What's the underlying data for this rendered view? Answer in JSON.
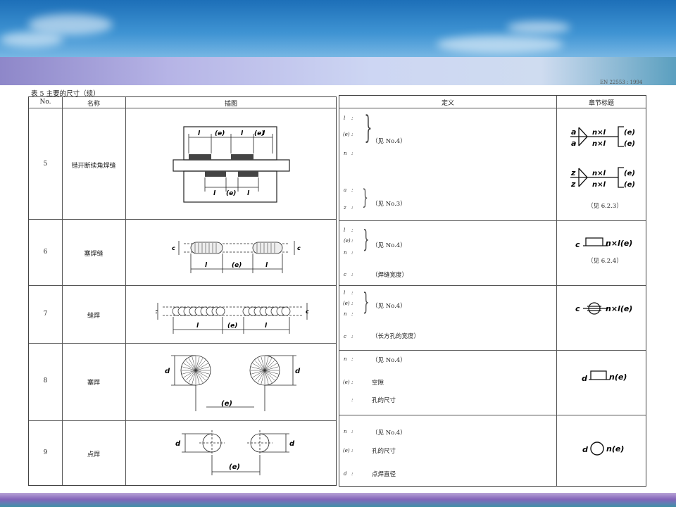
{
  "table": {
    "caption": "表 5  主要的尺寸（续）",
    "doc_code": "EN 22553 : 1994",
    "headers": {
      "no": "No.",
      "name": "名称",
      "figure": "插图",
      "definition": "定义",
      "section": "章节标题"
    },
    "rows": [
      {
        "no": "5",
        "name": "错开断续角焊缝",
        "figure_labels": {
          "l1": "l",
          "e1": "(e)",
          "l2": "l",
          "e2": "(e)",
          "l3": "l",
          "l4": "l",
          "e3": "(e)",
          "l5": "l"
        },
        "definitions": [
          {
            "symbols": [
              "l",
              "(e)",
              "n"
            ],
            "text": "（见 No.4）"
          },
          {
            "symbols": [
              "a",
              "z"
            ],
            "text": "（见 No.3）"
          }
        ],
        "symbols": [
          {
            "top": "a",
            "bottom": "a",
            "top_text": "n×l",
            "bottom_text": "n×l",
            "top_e": "(e)",
            "bottom_e": "(e)"
          },
          {
            "top": "z",
            "bottom": "z",
            "top_text": "n×l",
            "bottom_text": "n×l",
            "top_e": "(e)",
            "bottom_e": "(e)"
          }
        ],
        "ref": "（见 6.2.3）"
      },
      {
        "no": "6",
        "name": "塞焊缝",
        "figure_labels": {
          "c1": "c",
          "c2": "c",
          "l1": "l",
          "e": "(e)",
          "l2": "l"
        },
        "definitions": [
          {
            "symbols": [
              "l",
              "(e)",
              "n"
            ],
            "text": "（见 No.4）"
          },
          {
            "symbols": [
              "c"
            ],
            "text": "（焊缝宽度）"
          }
        ],
        "symbol_text": "n×l(e)",
        "symbol_prefix": "c",
        "ref": "（见 6.2.4）"
      },
      {
        "no": "7",
        "name": "缝焊",
        "figure_labels": {
          "c1": "c",
          "c2": "c",
          "l1": "l",
          "e": "(e)",
          "l2": "l"
        },
        "definitions": [
          {
            "symbols": [
              "l",
              "(e)",
              "n"
            ],
            "text": "（见 No.4）"
          },
          {
            "symbols": [
              "c"
            ],
            "text": "（长方孔的宽度）"
          }
        ],
        "symbol_text": "n×l(e)",
        "symbol_prefix": "c"
      },
      {
        "no": "8",
        "name": "塞焊",
        "figure_labels": {
          "d1": "d",
          "d2": "d",
          "e": "(e)"
        },
        "definitions": [
          {
            "symbols": [
              "n"
            ],
            "text": "（见 No.4）"
          },
          {
            "symbols": [
              "(e)"
            ],
            "text": "空隙"
          },
          {
            "symbols": [
              ""
            ],
            "text": "孔的尺寸"
          }
        ],
        "symbol_text": "n(e)",
        "symbol_prefix": "d"
      },
      {
        "no": "9",
        "name": "点焊",
        "figure_labels": {
          "d1": "d",
          "d2": "d",
          "e": "(e)"
        },
        "definitions": [
          {
            "symbols": [
              "n"
            ],
            "text": "（见 No.4）"
          },
          {
            "symbols": [
              "(e)"
            ],
            "text": "孔的尺寸"
          },
          {
            "symbols": [
              "d"
            ],
            "text": "点焊直径"
          }
        ],
        "symbol_text": "n(e)",
        "symbol_prefix": "d"
      }
    ]
  }
}
